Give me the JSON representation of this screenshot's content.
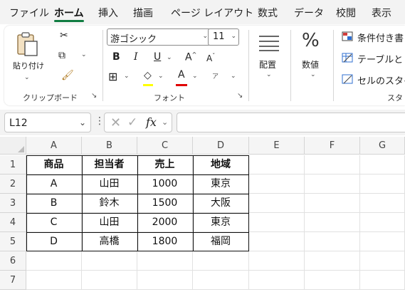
{
  "menu": {
    "tabs": [
      {
        "label": "ファイル",
        "active": false
      },
      {
        "label": "ホーム",
        "active": true
      },
      {
        "label": "挿入",
        "active": false
      },
      {
        "label": "描画",
        "active": false
      },
      {
        "label": "ページ レイアウト",
        "active": false
      },
      {
        "label": "数式",
        "active": false
      },
      {
        "label": "データ",
        "active": false
      },
      {
        "label": "校閲",
        "active": false
      },
      {
        "label": "表示",
        "active": false
      }
    ],
    "accent_color": "#107c41"
  },
  "ribbon": {
    "clipboard": {
      "paste_label": "貼り付け",
      "group_label": "クリップボード"
    },
    "font": {
      "font_name": "游ゴシック",
      "font_size": "11",
      "bold": "B",
      "italic": "I",
      "underline": "U",
      "grow": "A",
      "shrink": "A",
      "font_color_glyph": "A",
      "phonetic_glyph": "ア",
      "group_label": "フォント"
    },
    "alignment": {
      "label": "配置"
    },
    "number": {
      "label": "数値",
      "glyph": "%"
    },
    "styles": {
      "conditional_format": "条件付き書",
      "format_table": "テーブルとし",
      "cell_styles": "セルのスタイ",
      "group_label": "スタ"
    }
  },
  "formula_bar": {
    "name_box": "L12",
    "fx": "fx",
    "formula": ""
  },
  "sheet": {
    "columns": [
      "A",
      "B",
      "C",
      "D",
      "E",
      "F",
      "G"
    ],
    "rows": [
      "1",
      "2",
      "3",
      "4",
      "5",
      "6",
      "7"
    ],
    "cells": [
      [
        "商品",
        "担当者",
        "売上",
        "地域",
        "",
        "",
        ""
      ],
      [
        "A",
        "山田",
        "1000",
        "東京",
        "",
        "",
        ""
      ],
      [
        "B",
        "鈴木",
        "1500",
        "大阪",
        "",
        "",
        ""
      ],
      [
        "C",
        "山田",
        "2000",
        "東京",
        "",
        "",
        ""
      ],
      [
        "D",
        "高橋",
        "1800",
        "福岡",
        "",
        "",
        ""
      ],
      [
        "",
        "",
        "",
        "",
        "",
        "",
        ""
      ],
      [
        "",
        "",
        "",
        "",
        "",
        "",
        ""
      ]
    ],
    "header_row_bold": true
  }
}
